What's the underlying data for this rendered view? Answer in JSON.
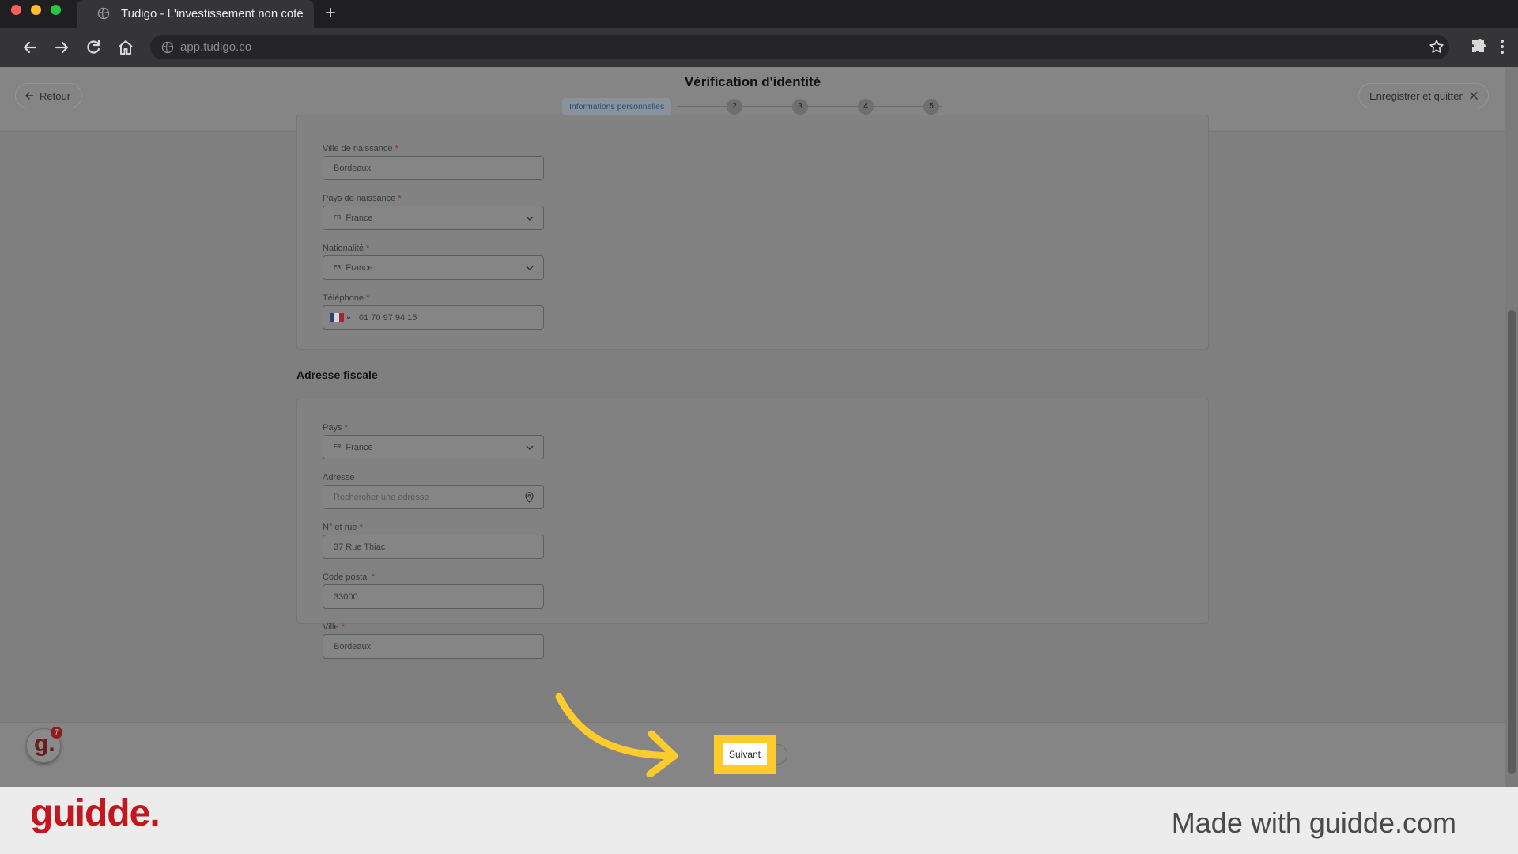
{
  "browser": {
    "tab_title": "Tudigo - L'investissement non coté",
    "url": "app.tudigo.co"
  },
  "header": {
    "back_label": "Retour",
    "title": "Vérification d'identité",
    "steps": [
      {
        "label": "Informations personnelles",
        "active": true
      },
      {
        "label": "2"
      },
      {
        "label": "3"
      },
      {
        "label": "4"
      },
      {
        "label": "5"
      }
    ],
    "save_quit_label": "Enregistrer et quitter"
  },
  "personal": {
    "birth_city": {
      "label": "Ville de naissance",
      "value": "Bordeaux"
    },
    "birth_country": {
      "label": "Pays de naissance",
      "flag_code": "FR",
      "value": "France"
    },
    "nationality": {
      "label": "Nationalité",
      "flag_code": "FR",
      "value": "France"
    },
    "phone": {
      "label": "Téléphone",
      "value": "01 70 97 94 15"
    }
  },
  "tax_address": {
    "title": "Adresse fiscale",
    "country": {
      "label": "Pays",
      "flag_code": "FR",
      "value": "France"
    },
    "address": {
      "label": "Adresse",
      "placeholder": "Rechercher une adresse"
    },
    "street": {
      "label": "N° et rue",
      "value": "37 Rue Thiac"
    },
    "postal_code": {
      "label": "Code postal",
      "value": "33000"
    },
    "city": {
      "label": "Ville",
      "value": "Bordeaux"
    }
  },
  "required_marker": "*",
  "footer": {
    "next_label": "Suivant",
    "badge_count": "7",
    "bubble_letter": "g."
  },
  "watermark": {
    "logo": "guidde.",
    "tagline": "Made with guidde.com"
  },
  "colors": {
    "highlight": "#fccb2c",
    "brand_red": "#c4161c",
    "active_step_text": "#1d4f7c"
  }
}
